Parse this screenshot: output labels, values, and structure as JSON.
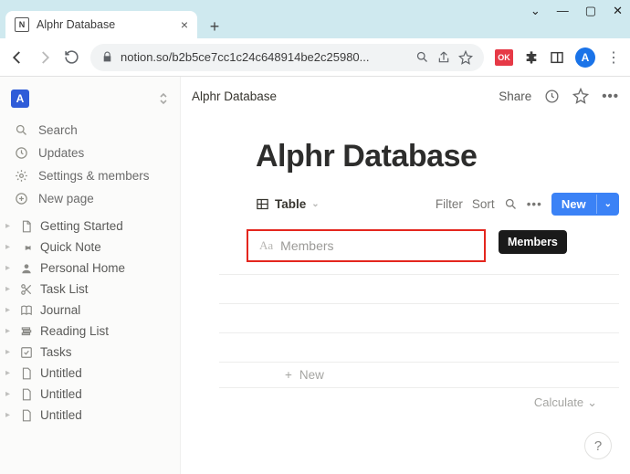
{
  "window": {
    "title": "Alphr Database"
  },
  "browser": {
    "url": "notion.so/b2b5ce7cc1c24c648914be2c25980...",
    "ext_badge": "OK",
    "profile_initial": "A"
  },
  "workspace": {
    "initial": "A"
  },
  "sidebar": {
    "search": "Search",
    "updates": "Updates",
    "settings": "Settings & members",
    "newpage": "New page",
    "pages": [
      {
        "icon": "doc",
        "label": "Getting Started"
      },
      {
        "icon": "pin",
        "label": "Quick Note"
      },
      {
        "icon": "person",
        "label": "Personal Home"
      },
      {
        "icon": "scissors",
        "label": "Task List"
      },
      {
        "icon": "book",
        "label": "Journal"
      },
      {
        "icon": "stack",
        "label": "Reading List"
      },
      {
        "icon": "check",
        "label": "Tasks"
      },
      {
        "icon": "page",
        "label": "Untitled"
      },
      {
        "icon": "page",
        "label": "Untitled"
      },
      {
        "icon": "page",
        "label": "Untitled"
      }
    ]
  },
  "topbar": {
    "breadcrumb": "Alphr Database",
    "share": "Share"
  },
  "page": {
    "title": "Alphr Database"
  },
  "db": {
    "view_label": "Table",
    "filter": "Filter",
    "sort": "Sort",
    "new_label": "New",
    "property_type_icon": "Aa",
    "property_name": "Members",
    "tooltip": "Members",
    "new_row": "New",
    "calculate": "Calculate"
  },
  "help": "?"
}
